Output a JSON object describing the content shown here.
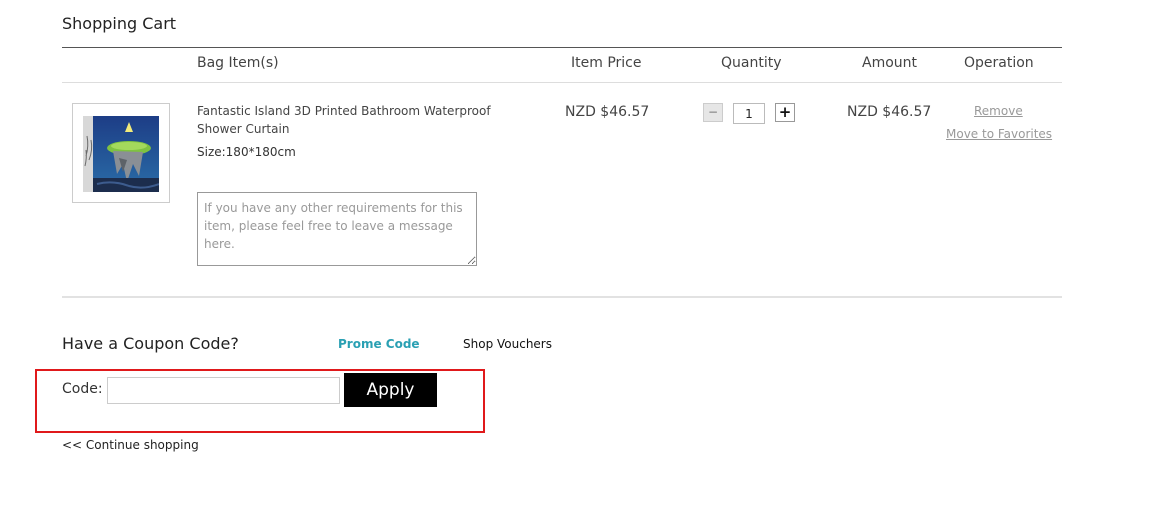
{
  "page": {
    "title": "Shopping Cart"
  },
  "table": {
    "headers": {
      "item": "Bag Item(s)",
      "price": "Item Price",
      "quantity": "Quantity",
      "amount": "Amount",
      "operation": "Operation"
    }
  },
  "cart_item": {
    "name": "Fantastic Island 3D Printed Bathroom Waterproof Shower Curtain",
    "size": "Size:180*180cm",
    "message_placeholder": "If you have any other requirements for this item, please feel free to leave a message here.",
    "price": "NZD $46.57",
    "quantity": "1",
    "qty_minus": "−",
    "qty_plus": "+",
    "amount": "NZD $46.57",
    "remove_label": "Remove",
    "favorites_label": "Move to Favorites"
  },
  "coupon": {
    "title": "Have a Coupon Code?",
    "tab_promo": "Prome Code",
    "tab_shop": "Shop Vouchers",
    "code_label": "Code:",
    "code_value": "",
    "apply_label": "Apply"
  },
  "footer": {
    "continue_label": "<< Continue shopping"
  },
  "colors": {
    "accent_teal": "#2aa0b3",
    "highlight_red": "#e0191b",
    "button_black": "#000000"
  }
}
